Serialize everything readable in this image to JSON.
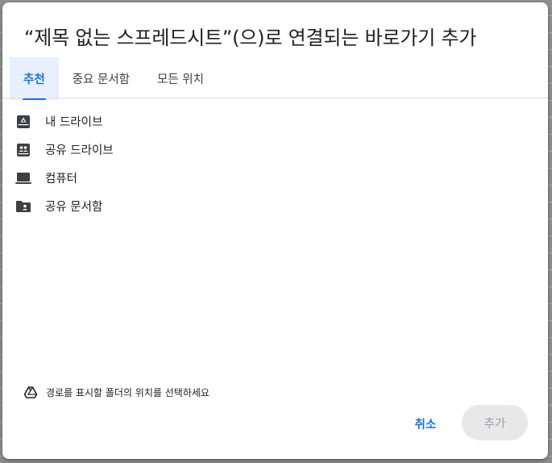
{
  "dialog": {
    "title": "“제목 없는 스프레드시트”(으)로 연결되는 바로가기 추가",
    "tabs": [
      {
        "label": "추천",
        "active": true
      },
      {
        "label": "중요 문서함",
        "active": false
      },
      {
        "label": "모든 위치",
        "active": false
      }
    ],
    "locations": [
      {
        "label": "내 드라이브",
        "icon": "my-drive-icon"
      },
      {
        "label": "공유 드라이브",
        "icon": "shared-drive-icon"
      },
      {
        "label": "컴퓨터",
        "icon": "computer-icon"
      },
      {
        "label": "공유 문서함",
        "icon": "shared-folder-icon"
      }
    ],
    "hint": {
      "text": "경로를 표시할 폴더의 위치를 선택하세요",
      "icon": "drive-icon"
    },
    "buttons": {
      "cancel": "취소",
      "add": "추가"
    }
  },
  "colors": {
    "accent": "#1a73e8",
    "active_tab_bg": "#e8f0fe",
    "disabled_button_bg": "#e8e8e8",
    "disabled_button_text": "#9aa0a6",
    "text": "#202124"
  }
}
